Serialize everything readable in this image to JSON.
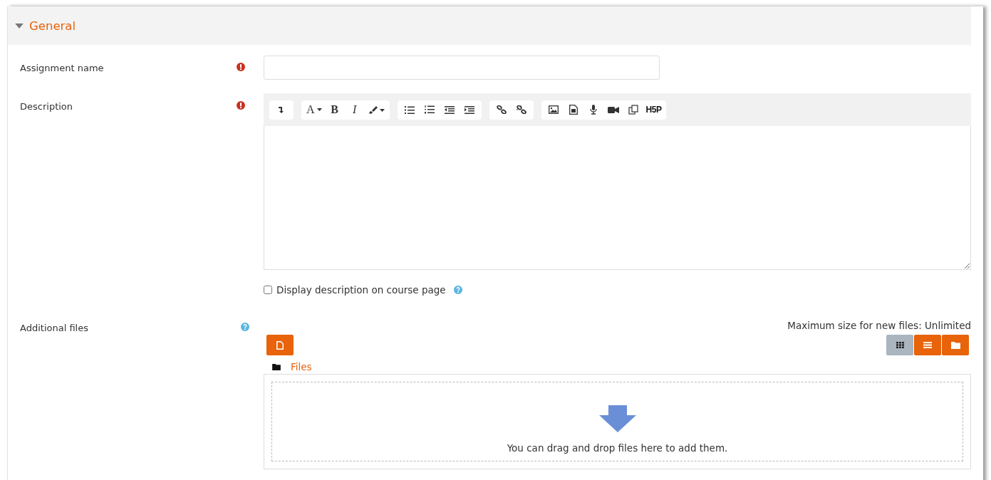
{
  "section": {
    "title": "General",
    "expanded": true
  },
  "assignment_name": {
    "label": "Assignment name",
    "required": true
  },
  "description": {
    "label": "Description",
    "required": true,
    "toolbar": [
      [
        {
          "kind": "collapse"
        }
      ],
      [
        {
          "kind": "font",
          "label": "A"
        },
        {
          "kind": "bold",
          "label": "B"
        },
        {
          "kind": "italic",
          "label": "I"
        },
        {
          "kind": "brush"
        }
      ],
      [
        {
          "kind": "bullets"
        },
        {
          "kind": "numbers"
        },
        {
          "kind": "outdent"
        },
        {
          "kind": "indent"
        }
      ],
      [
        {
          "kind": "link"
        },
        {
          "kind": "unlink"
        }
      ],
      [
        {
          "kind": "image"
        },
        {
          "kind": "media"
        },
        {
          "kind": "mic"
        },
        {
          "kind": "video"
        },
        {
          "kind": "copy"
        },
        {
          "kind": "h5p",
          "label": "H5P"
        }
      ]
    ]
  },
  "display_description": {
    "label": "Display description on course page",
    "checked": false
  },
  "additional_files": {
    "label": "Additional files",
    "max_size": "Maximum size for new files: Unlimited",
    "view_modes": [
      {
        "kind": "grid",
        "selected": true
      },
      {
        "kind": "list",
        "selected": false
      },
      {
        "kind": "tree",
        "selected": false
      }
    ],
    "path": "Files",
    "drop_hint": "You can drag and drop files here to add them."
  }
}
